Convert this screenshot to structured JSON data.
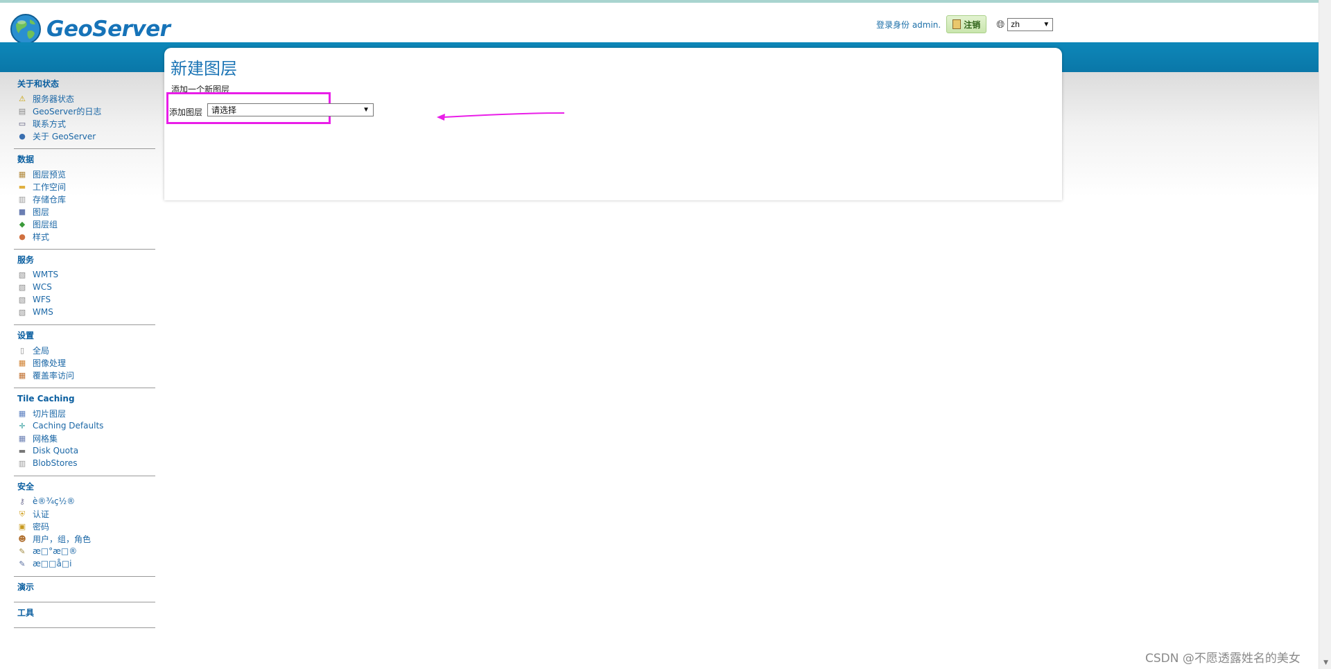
{
  "header": {
    "logo_text": "GeoServer",
    "login_text": "登录身份 admin.",
    "logout_label": "注销",
    "language": "zh"
  },
  "sidebar": {
    "sections": [
      {
        "title": "关于和状态",
        "items": [
          {
            "label": "服务器状态",
            "icon": "server-status-icon"
          },
          {
            "label": "GeoServer的日志",
            "icon": "log-icon"
          },
          {
            "label": "联系方式",
            "icon": "contact-icon"
          },
          {
            "label": "关于 GeoServer",
            "icon": "about-icon"
          }
        ]
      },
      {
        "title": "数据",
        "items": [
          {
            "label": "图层预览",
            "icon": "layer-preview-icon"
          },
          {
            "label": "工作空间",
            "icon": "workspace-icon"
          },
          {
            "label": "存储仓库",
            "icon": "store-icon"
          },
          {
            "label": "图层",
            "icon": "layer-icon"
          },
          {
            "label": "图层组",
            "icon": "layer-group-icon"
          },
          {
            "label": "样式",
            "icon": "style-icon"
          }
        ]
      },
      {
        "title": "服务",
        "items": [
          {
            "label": "WMTS",
            "icon": "service-icon"
          },
          {
            "label": "WCS",
            "icon": "service-icon"
          },
          {
            "label": "WFS",
            "icon": "service-icon"
          },
          {
            "label": "WMS",
            "icon": "service-icon"
          }
        ]
      },
      {
        "title": "设置",
        "items": [
          {
            "label": "全局",
            "icon": "global-icon"
          },
          {
            "label": "图像处理",
            "icon": "image-processing-icon"
          },
          {
            "label": "覆盖率访问",
            "icon": "coverage-access-icon"
          }
        ]
      },
      {
        "title": "Tile Caching",
        "items": [
          {
            "label": "切片图层",
            "icon": "tile-layer-icon"
          },
          {
            "label": "Caching Defaults",
            "icon": "caching-defaults-icon"
          },
          {
            "label": "网格集",
            "icon": "gridset-icon"
          },
          {
            "label": "Disk Quota",
            "icon": "disk-quota-icon"
          },
          {
            "label": "BlobStores",
            "icon": "blobstore-icon"
          }
        ]
      },
      {
        "title": "安全",
        "items": [
          {
            "label": "è®¾ç½®",
            "icon": "key-icon"
          },
          {
            "label": "认证",
            "icon": "shield-icon"
          },
          {
            "label": "密码",
            "icon": "lock-icon"
          },
          {
            "label": "用户，组，角色",
            "icon": "users-icon"
          },
          {
            "label": "æ□°æ□®",
            "icon": "data-security-icon"
          },
          {
            "label": "æ□□å□i",
            "icon": "service-security-icon"
          }
        ]
      },
      {
        "title": "演示",
        "items": []
      },
      {
        "title": "工具",
        "items": []
      }
    ]
  },
  "main": {
    "title": "新建图层",
    "subtitle": "添加一个新图层",
    "add_layer_label": "添加图层",
    "select_placeholder": "请选择"
  },
  "watermark": "CSDN @不愿透露姓名的美女",
  "colors": {
    "brand_blue": "#0d87b9",
    "highlight": "#e91ee8"
  }
}
